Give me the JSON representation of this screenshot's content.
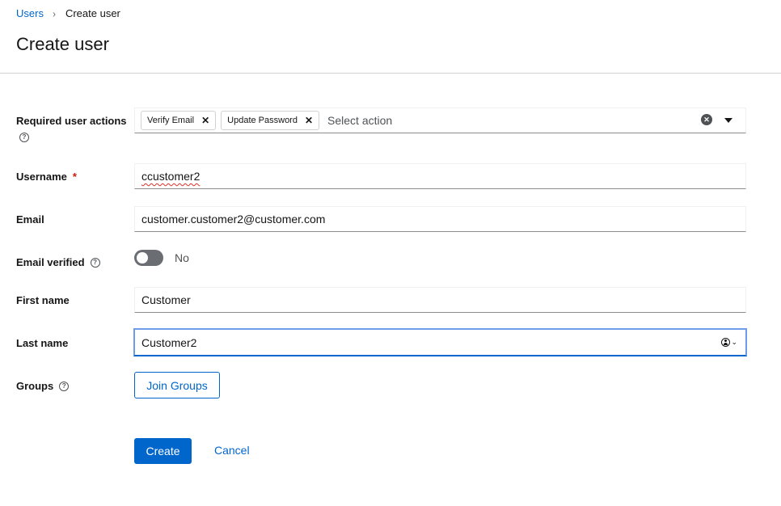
{
  "breadcrumb": {
    "parent": "Users",
    "separator": "›",
    "current": "Create user"
  },
  "page_title": "Create user",
  "form": {
    "required_actions": {
      "label": "Required user actions",
      "chips": [
        {
          "label": "Verify Email",
          "remove": "✕"
        },
        {
          "label": "Update Password",
          "remove": "✕"
        }
      ],
      "placeholder": "Select action",
      "clear": "✕"
    },
    "username": {
      "label": "Username",
      "required_mark": "*",
      "value": "ccustomer2"
    },
    "email": {
      "label": "Email",
      "value": "customer.customer2@customer.com"
    },
    "email_verified": {
      "label": "Email verified",
      "state_label": "No",
      "checked": false
    },
    "first_name": {
      "label": "First name",
      "value": "Customer"
    },
    "last_name": {
      "label": "Last name",
      "value": "Customer2",
      "autofill_chevron": "⌄"
    },
    "groups": {
      "label": "Groups",
      "button": "Join Groups"
    },
    "help_glyph": "?"
  },
  "actions": {
    "create": "Create",
    "cancel": "Cancel"
  },
  "colors": {
    "primary": "#0066cc",
    "required": "#c9190b",
    "toggle_off": "#6a6e73",
    "focus": "#6f9ce8"
  }
}
